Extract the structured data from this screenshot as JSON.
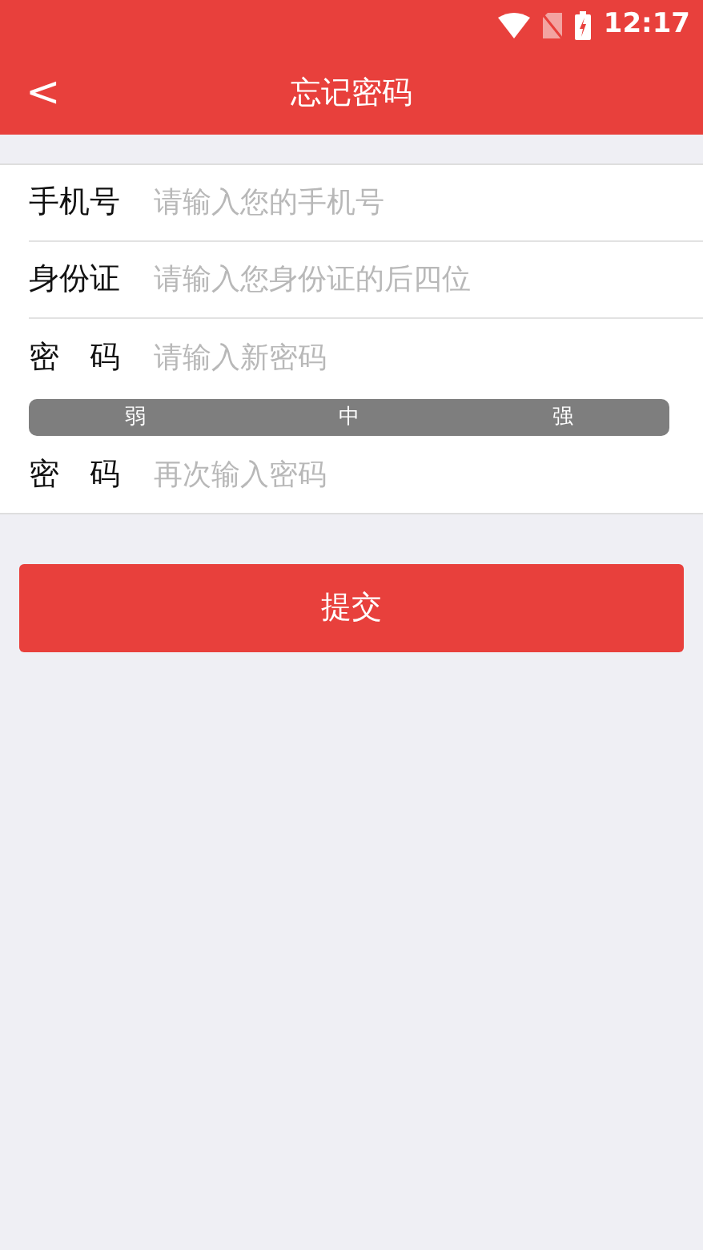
{
  "status_bar": {
    "time": "12:17"
  },
  "header": {
    "back": "<",
    "title": "忘记密码"
  },
  "fields": [
    {
      "kind": "input",
      "label": "手机号",
      "placeholder": "请输入您的手机号"
    },
    {
      "kind": "input",
      "label": "身份证",
      "placeholder": "请输入您身份证的后四位"
    },
    {
      "kind": "input",
      "label": "密　码",
      "placeholder": "请输入新密码"
    },
    {
      "kind": "strength",
      "levels": [
        {
          "label": "弱",
          "active": false
        },
        {
          "label": "中",
          "active": false
        },
        {
          "label": "强",
          "active": false
        }
      ]
    },
    {
      "kind": "input",
      "label": "密　码",
      "placeholder": "再次输入密码"
    }
  ],
  "submit": "提交"
}
